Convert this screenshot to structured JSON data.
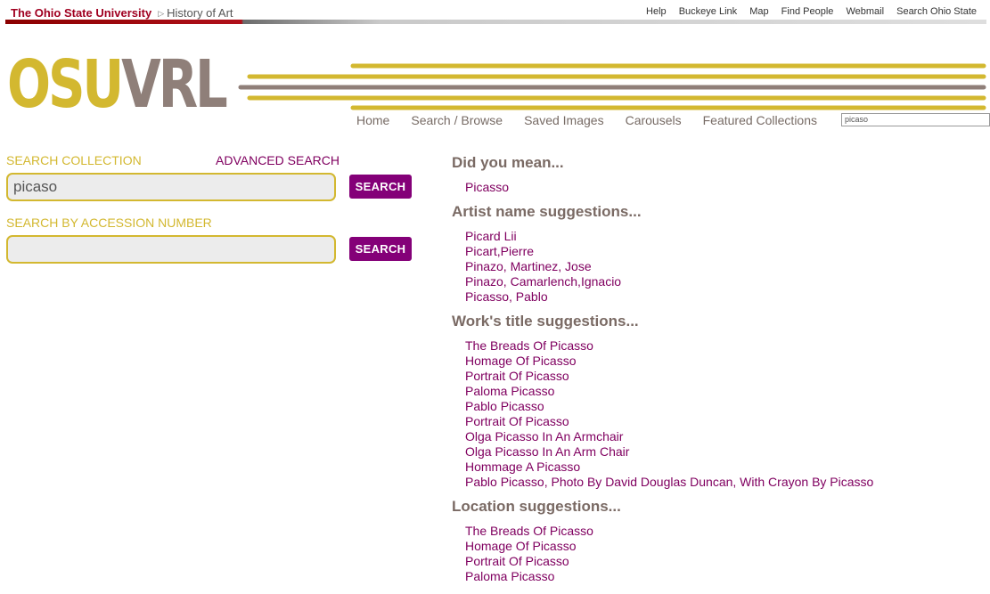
{
  "osu_bar": {
    "university": "The Ohio State University",
    "department": "History of Art",
    "links": [
      "Help",
      "Buckeye Link",
      "Map",
      "Find People",
      "Webmail",
      "Search Ohio State"
    ]
  },
  "header": {
    "logo_part1": "OSU",
    "logo_part2": "VRL",
    "colors": {
      "gold": "#d3b830",
      "taupe": "#8f7f79",
      "purple": "#840078",
      "scarlet": "#a00020"
    }
  },
  "nav": {
    "items": [
      "Home",
      "Search / Browse",
      "Saved Images",
      "Carousels",
      "Featured Collections"
    ],
    "search_value": "picaso"
  },
  "left": {
    "search_collection_label": "SEARCH COLLECTION",
    "advanced_search_label": "ADVANCED SEARCH",
    "search_value": "picaso",
    "search_button": "SEARCH",
    "accession_label": "SEARCH BY ACCESSION NUMBER",
    "accession_value": "",
    "accession_button": "SEARCH"
  },
  "suggestions": [
    {
      "title": "Did you mean...",
      "items": [
        "Picasso"
      ]
    },
    {
      "title": "Artist name suggestions...",
      "items": [
        "Picard Lii",
        "Picart,Pierre",
        "Pinazo, Martinez, Jose",
        "Pinazo, Camarlench,Ignacio",
        "Picasso, Pablo"
      ]
    },
    {
      "title": "Work's title suggestions...",
      "items": [
        "The Breads Of Picasso",
        "Homage Of Picasso",
        "Portrait Of Picasso",
        "Paloma Picasso",
        "Pablo Picasso",
        "Portrait Of Picasso",
        "Olga Picasso In An Armchair",
        "Olga Picasso In An Arm Chair",
        "Hommage A Picasso",
        "Pablo Picasso, Photo By David Douglas Duncan, With Crayon By Picasso"
      ]
    },
    {
      "title": "Location suggestions...",
      "items": [
        "The Breads Of Picasso",
        "Homage Of Picasso",
        "Portrait Of Picasso",
        "Paloma Picasso"
      ]
    }
  ]
}
